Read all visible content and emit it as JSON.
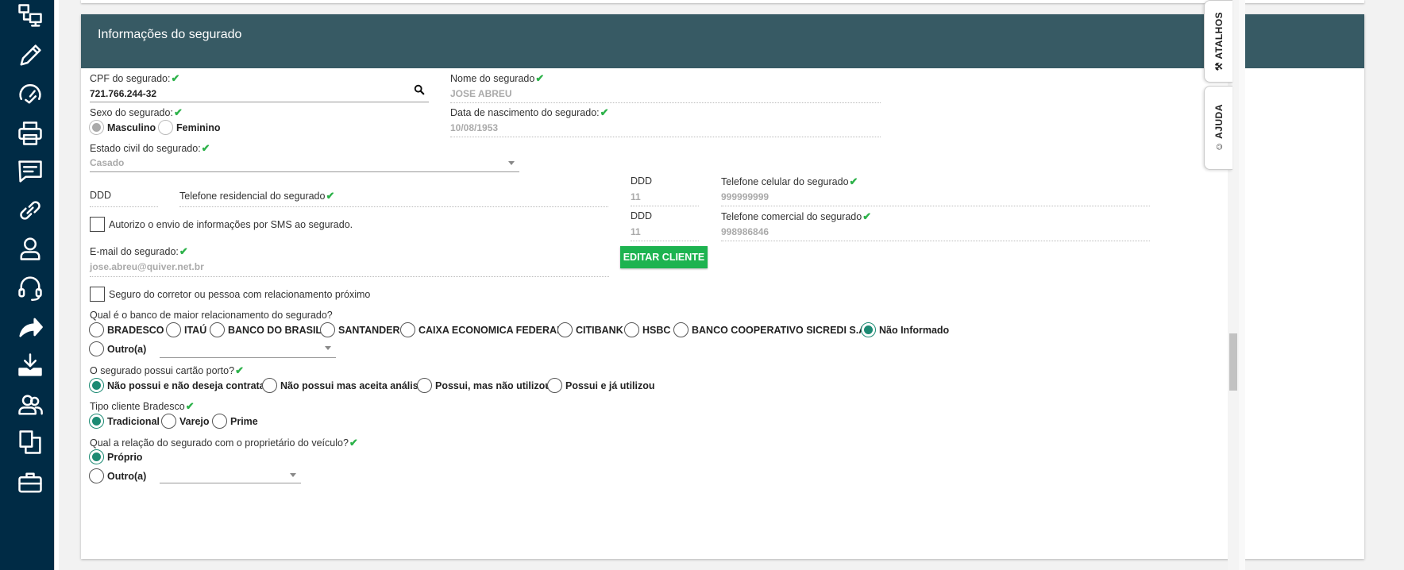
{
  "section": {
    "title": "Informações do segurado"
  },
  "cpf": {
    "label": "CPF do segurado:",
    "value": "721.766.244-32"
  },
  "nome": {
    "label": "Nome do segurado",
    "value": "JOSE ABREU"
  },
  "sexo": {
    "label": "Sexo do segurado:",
    "options": [
      "Masculino",
      "Feminino"
    ],
    "selected": "Masculino"
  },
  "nascimento": {
    "label": "Data de nascimento do segurado:",
    "value": "10/08/1953"
  },
  "estado_civil": {
    "label": "Estado civil do segurado:",
    "value": "Casado"
  },
  "tel_residencial": {
    "ddd_label": "DDD",
    "label": "Telefone residencial do segurado"
  },
  "tel_celular": {
    "ddd_label": "DDD",
    "ddd_value": "11",
    "label": "Telefone celular do segurado",
    "value": "999999999"
  },
  "tel_comercial": {
    "ddd_label": "DDD",
    "ddd_value": "11",
    "label": "Telefone comercial do segurado",
    "value": "998986846"
  },
  "sms": {
    "label": "Autorizo o envio de informações por SMS ao segurado."
  },
  "email": {
    "label": "E-mail do segurado:",
    "value": "jose.abreu@quiver.net.br"
  },
  "editar_button": "EDITAR CLIENTE",
  "corretor": {
    "label": "Seguro do corretor ou pessoa com relacionamento próximo"
  },
  "banco": {
    "label": "Qual é o banco de maior relacionamento do segurado?",
    "options": [
      "BRADESCO",
      "ITAÚ",
      "BANCO DO BRASIL",
      "SANTANDER",
      "CAIXA ECONOMICA FEDERAL",
      "CITIBANK",
      "HSBC",
      "BANCO COOPERATIVO SICREDI S.A.",
      "Não Informado"
    ],
    "selected": "Não Informado",
    "other_label": "Outro(a)"
  },
  "cartao": {
    "label": "O segurado possui cartão porto?",
    "options": [
      "Não possui e não deseja contratar",
      "Não possui mas aceita análise",
      "Possui, mas não utilizou",
      "Possui e já utilizou"
    ],
    "selected": "Não possui e não deseja contratar"
  },
  "tipo_bradesco": {
    "label": "Tipo cliente Bradesco",
    "options": [
      "Tradicional",
      "Varejo",
      "Prime"
    ],
    "selected": "Tradicional"
  },
  "relacao": {
    "label": "Qual a relação do segurado com o proprietário do veículo?",
    "options": [
      "Próprio",
      "Outro(a)"
    ],
    "selected": "Próprio"
  },
  "side_tabs": {
    "atalhos": "ATALHOS",
    "ajuda": "AJUDA"
  },
  "check_mark": "✔",
  "accent_color": "#1c8a73",
  "header_color": "#375a64",
  "button_color": "#1db350"
}
